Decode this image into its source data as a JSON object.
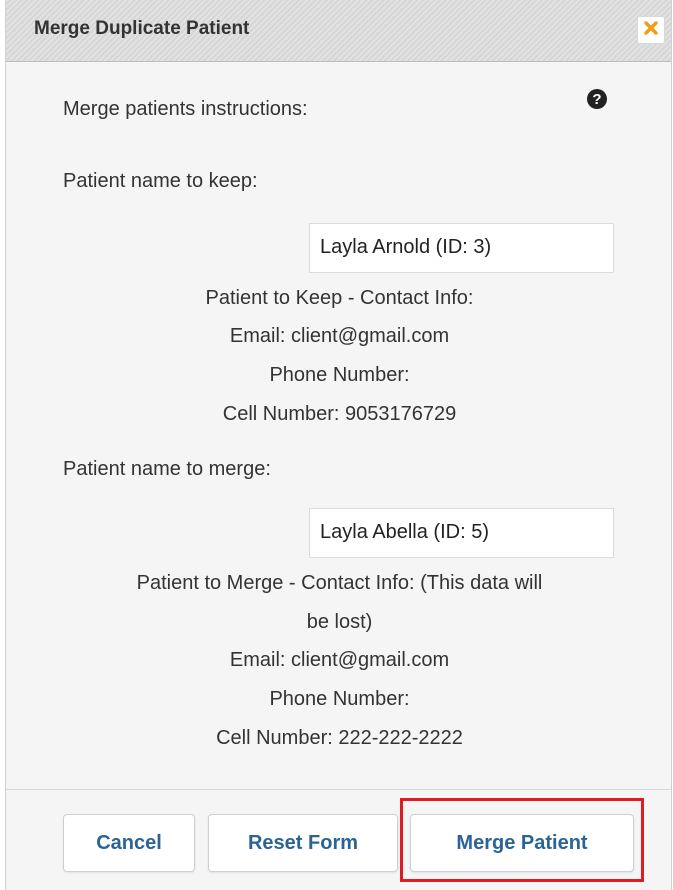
{
  "dialog": {
    "title": "Merge Duplicate Patient",
    "close_icon": "close-x-icon",
    "help_icon": "question-circle-icon",
    "instructions_label": "Merge patients instructions:",
    "keep": {
      "label": "Patient name to keep:",
      "value": "Layla Arnold (ID: 3)",
      "contact_heading": "Patient to Keep - Contact Info:",
      "email": "Email: client@gmail.com",
      "phone": "Phone Number:",
      "cell": "Cell Number: 9053176729"
    },
    "merge": {
      "label": "Patient name to merge:",
      "value": "Layla Abella (ID: 5)",
      "contact_heading_line1": "Patient to Merge - Contact Info: (This data will",
      "contact_heading_line2": "be lost)",
      "email": "Email: client@gmail.com",
      "phone": "Phone Number:",
      "cell": "Cell Number: 222-222-2222"
    }
  },
  "buttons": {
    "cancel": "Cancel",
    "reset": "Reset Form",
    "merge": "Merge Patient"
  },
  "colors": {
    "accent_close": "#f39c12",
    "button_text": "#2a6496",
    "highlight": "#e01b24"
  }
}
